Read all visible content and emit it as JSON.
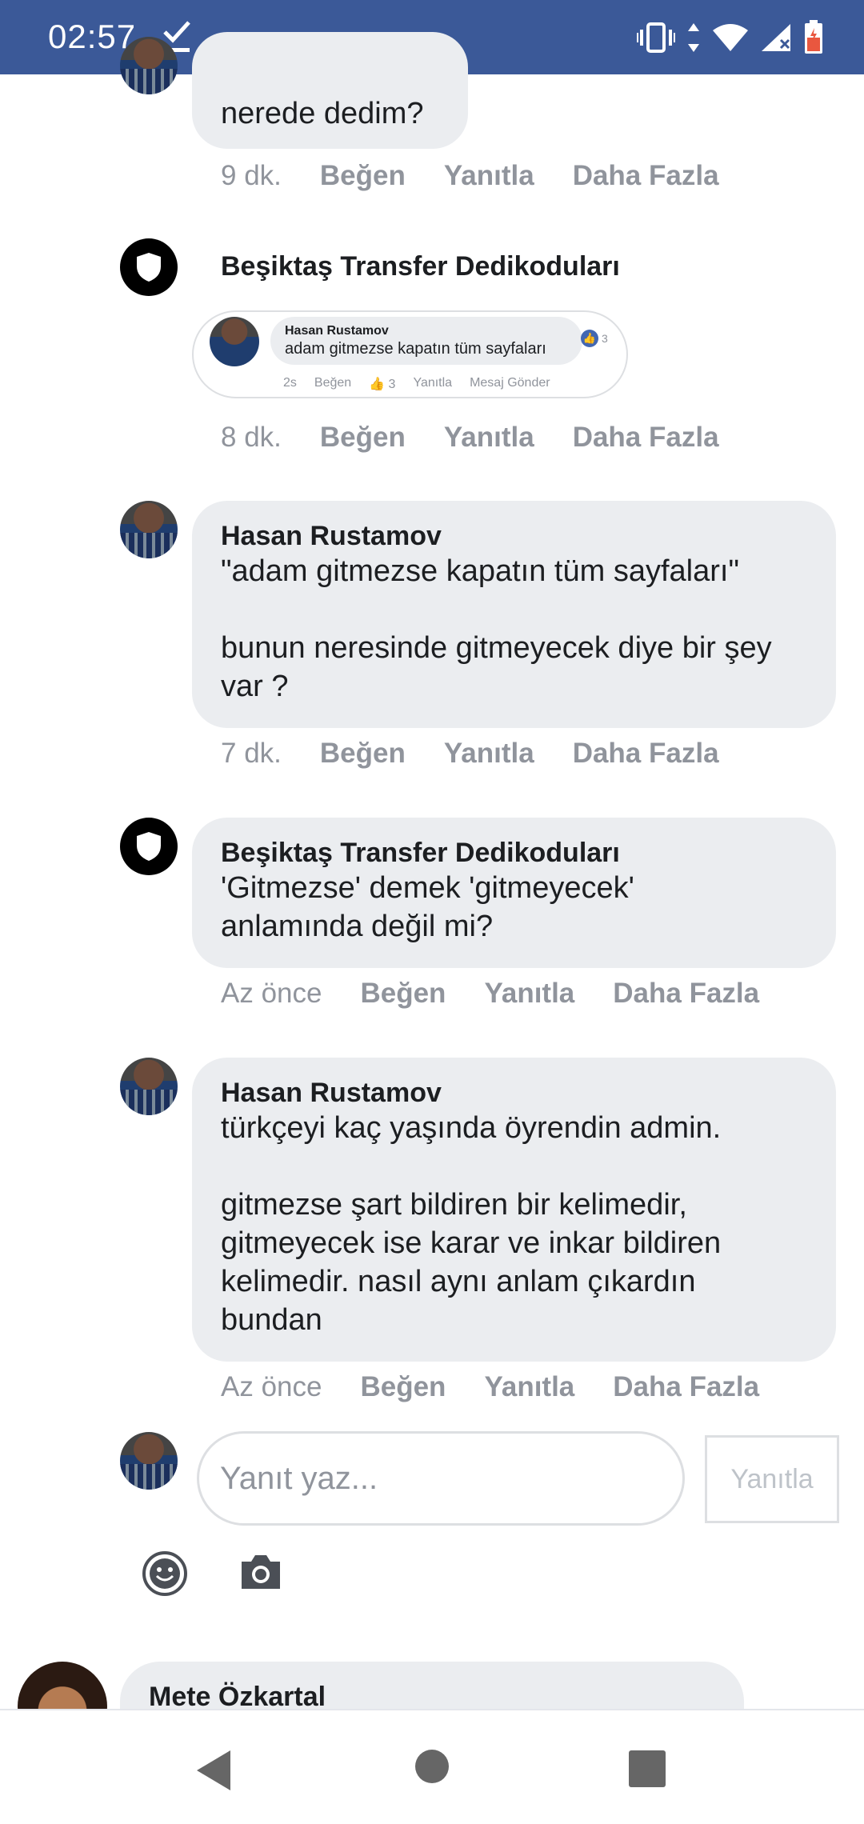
{
  "status_bar": {
    "time": "02:57"
  },
  "comments": [
    {
      "author": "Hasan Rustamov",
      "text": "nerede dedim?",
      "time": "9 dk.",
      "like": "Beğen",
      "reply": "Yanıtla",
      "more": "Daha Fazla"
    },
    {
      "author": "Beşiktaş Transfer Dedikoduları",
      "embedded": {
        "author": "Hasan Rustamov",
        "text": "adam gitmezse kapatın tüm sayfaları",
        "like_count": "3",
        "time": "2s",
        "like": "Beğen",
        "likes_inline": "3",
        "reply": "Yanıtla",
        "message": "Mesaj Gönder"
      },
      "time": "8 dk.",
      "like": "Beğen",
      "reply": "Yanıtla",
      "more": "Daha Fazla"
    },
    {
      "author": "Hasan Rustamov",
      "text": "\"adam gitmezse kapatın tüm sayfaları\"\n\nbunun neresinde gitmeyecek diye bir şey var ?",
      "time": "7 dk.",
      "like": "Beğen",
      "reply": "Yanıtla",
      "more": "Daha Fazla"
    },
    {
      "author": "Beşiktaş Transfer Dedikoduları",
      "text": "'Gitmezse' demek 'gitmeyecek' anlamında değil mi?",
      "time": "Az önce",
      "like": "Beğen",
      "reply": "Yanıtla",
      "more": "Daha Fazla"
    },
    {
      "author": "Hasan Rustamov",
      "text": "türkçeyi kaç yaşında öyrendin admin.\n\ngitmezse şart bildiren bir kelimedir, gitmeyecek ise karar ve inkar bildiren kelimedir. nasıl aynı anlam çıkardın bundan",
      "time": "Az önce",
      "like": "Beğen",
      "reply": "Yanıtla",
      "more": "Daha Fazla"
    }
  ],
  "reply_box": {
    "placeholder": "Yanıt yaz...",
    "button": "Yanıtla"
  },
  "next_comment": {
    "author": "Mete Özkartal"
  },
  "icons": [
    "check-icon",
    "vibrate-icon",
    "data-arrows-icon",
    "wifi-icon",
    "signal-icon",
    "battery-icon",
    "emoji-icon",
    "camera-icon",
    "back-icon",
    "home-icon",
    "recents-icon"
  ],
  "colors": {
    "status_bar": "#3b5998",
    "bubble": "#ebedf0",
    "meta_text": "#90949c"
  }
}
